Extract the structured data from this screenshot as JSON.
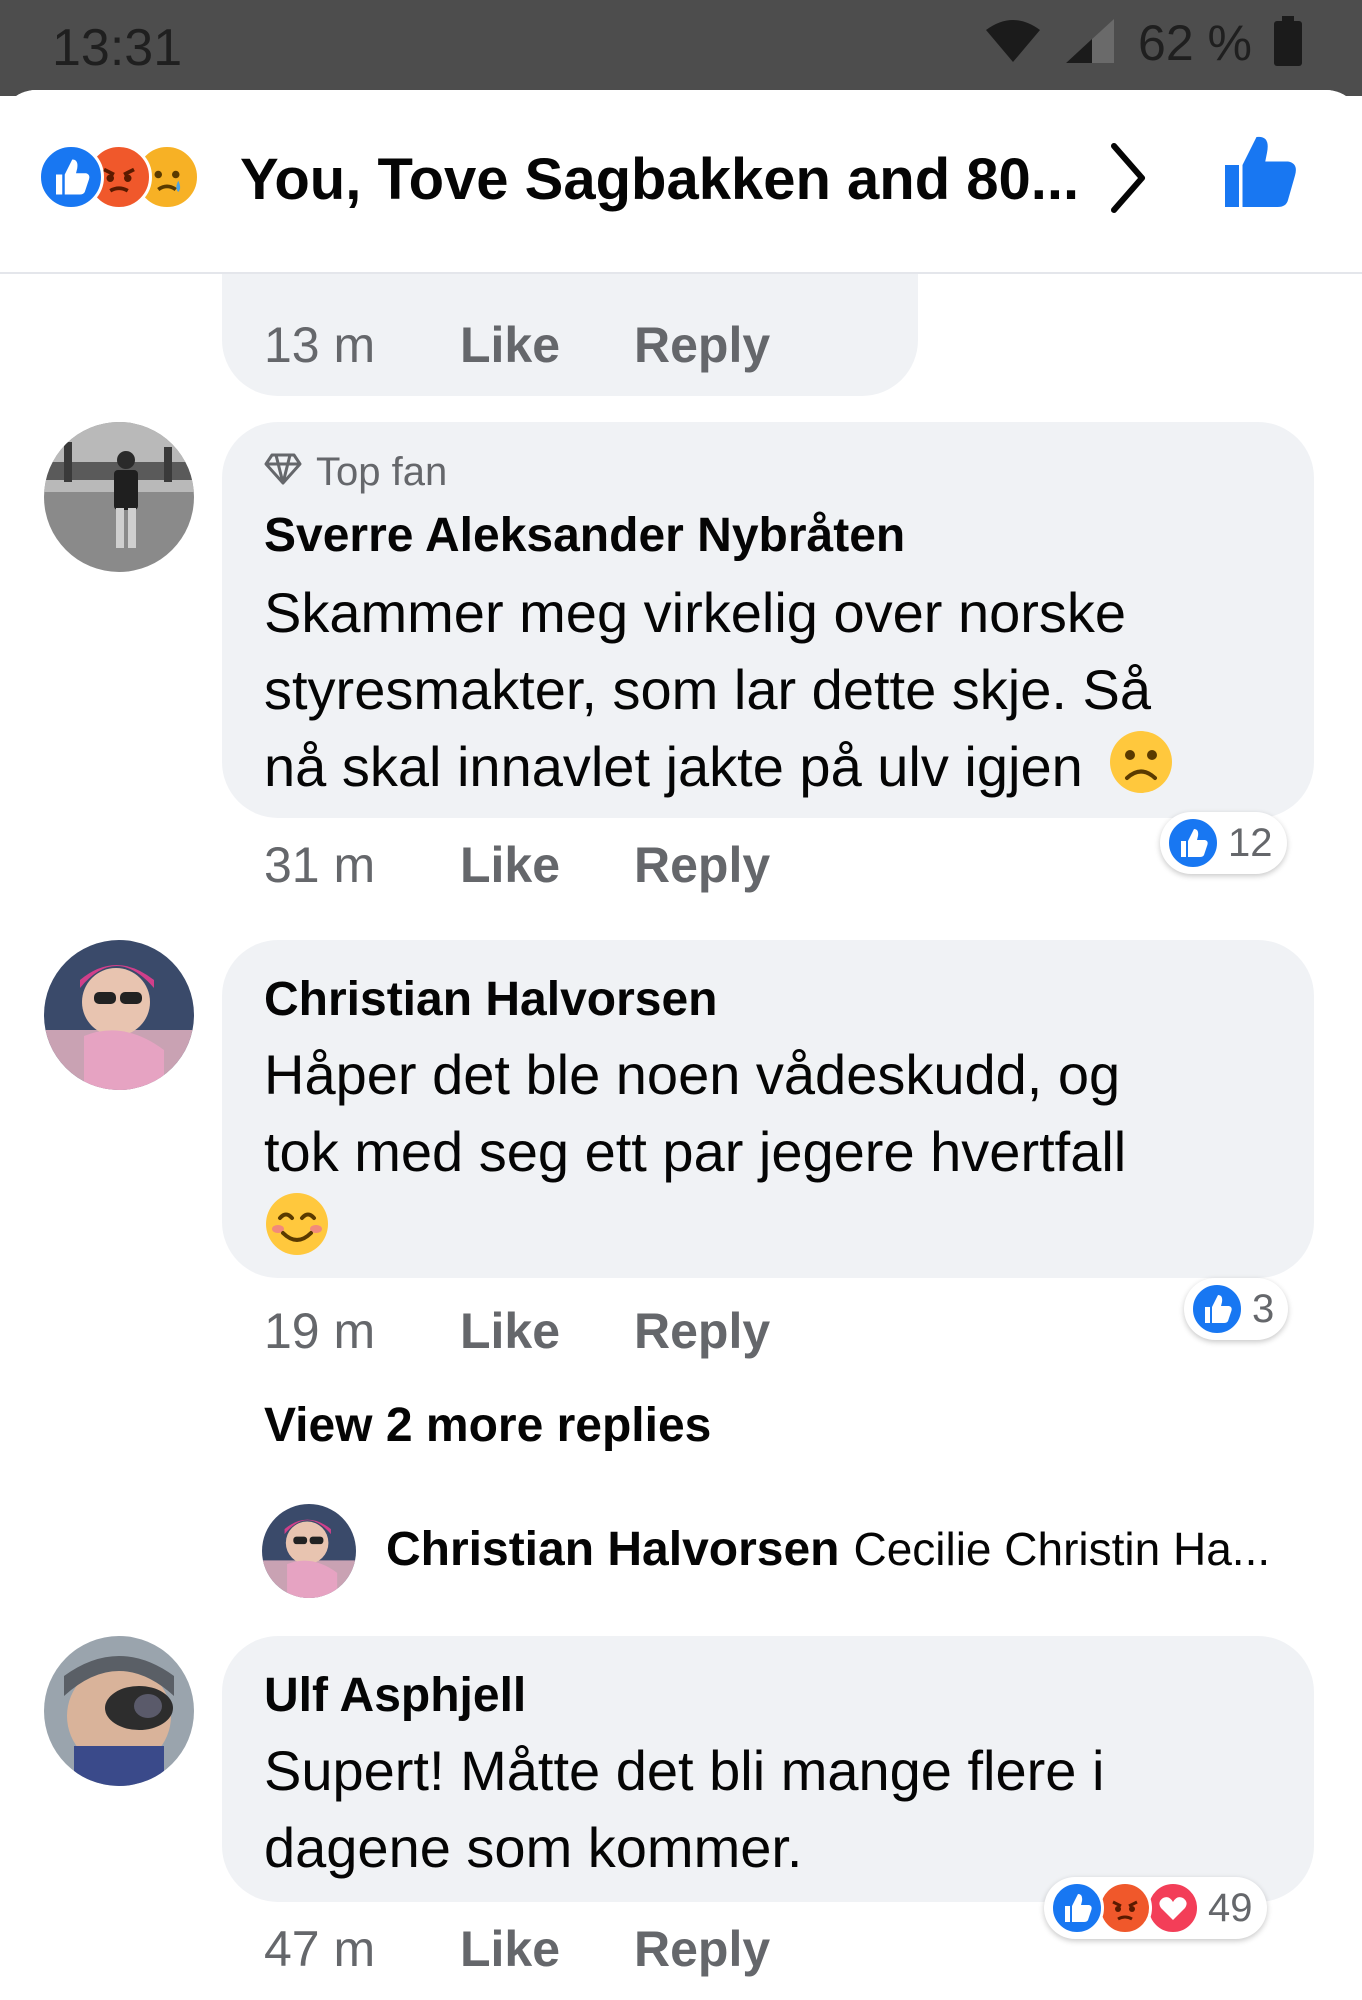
{
  "status": {
    "time": "13:31",
    "battery": "62 %"
  },
  "header": {
    "title": "You, Tove Sagbakken and 80...",
    "reactions": [
      "like",
      "angry",
      "sad"
    ]
  },
  "previous_comment": {
    "time": "13 m",
    "like_label": "Like",
    "reply_label": "Reply"
  },
  "comments": [
    {
      "badge": "Top fan",
      "author": "Sverre Aleksander Nybråten",
      "lines": [
        "Skammer meg virkelig over norske",
        "styresmakter, som lar dette skje. Så",
        "nå skal innavlet jakte på ulv igjen"
      ],
      "emoji": "frowning",
      "time": "31 m",
      "like_label": "Like",
      "reply_label": "Reply",
      "reaction_count": "12",
      "reactions": [
        "like"
      ]
    },
    {
      "author": "Christian Halvorsen",
      "lines": [
        "Håper det ble noen vådeskudd, og",
        "tok med seg ett par jegere hvertfall"
      ],
      "emoji": "smiling",
      "time": "19 m",
      "like_label": "Like",
      "reply_label": "Reply",
      "reaction_count": "3",
      "reactions": [
        "like"
      ],
      "view_more": "View 2 more replies",
      "reply_preview": {
        "author": "Christian Halvorsen",
        "text": "Cecilie Christin Ha..."
      }
    },
    {
      "author": "Ulf Asphjell",
      "lines": [
        "Supert! Måtte det bli mange flere i",
        "dagene som kommer."
      ],
      "time": "47 m",
      "like_label": "Like",
      "reply_label": "Reply",
      "reaction_count": "49",
      "reactions": [
        "like",
        "angry",
        "love"
      ]
    }
  ],
  "colors": {
    "like_blue": "#1877f2",
    "angry_orange": "#f0582b",
    "love_red": "#f33e58",
    "bubble_bg": "#f0f2f5",
    "meta_gray": "#65676b"
  }
}
